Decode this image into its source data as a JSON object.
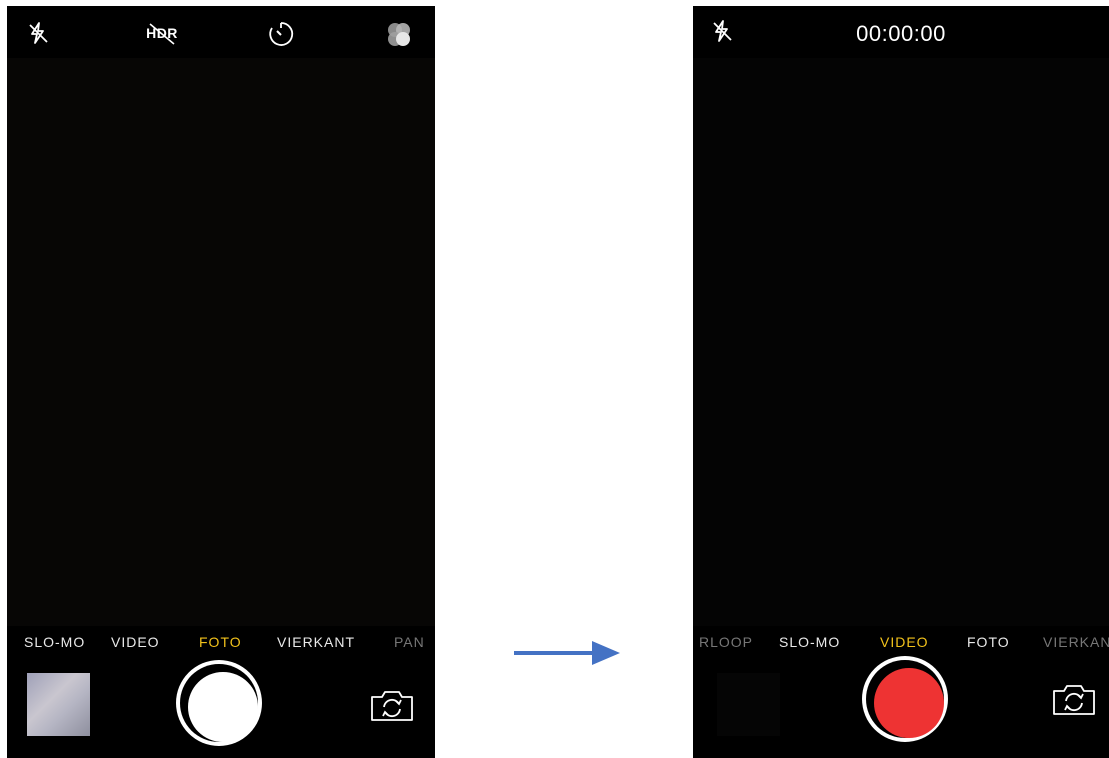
{
  "photo_screen": {
    "top_icons": [
      "flash-off-icon",
      "hdr-off-icon",
      "timer-icon",
      "filters-icon"
    ],
    "hdr_label": "HDR",
    "modes": [
      {
        "label": "SLO-MO",
        "state": "normal"
      },
      {
        "label": "VIDEO",
        "state": "normal"
      },
      {
        "label": "FOTO",
        "state": "active"
      },
      {
        "label": "VIERKANT",
        "state": "normal"
      },
      {
        "label": "PAN",
        "state": "faded"
      }
    ],
    "shutter": "photo-shutter",
    "flip_icon": "camera-flip-icon"
  },
  "video_screen": {
    "top_icons": [
      "flash-off-icon"
    ],
    "timer": "00:00:00",
    "modes": [
      {
        "label": "RLOOP",
        "state": "faded"
      },
      {
        "label": "SLO-MO",
        "state": "normal"
      },
      {
        "label": "VIDEO",
        "state": "active"
      },
      {
        "label": "FOTO",
        "state": "normal"
      },
      {
        "label": "VIERKAN",
        "state": "faded"
      }
    ],
    "shutter": "record-button",
    "flip_icon": "camera-flip-icon"
  },
  "transition_icon": "arrow-right-icon",
  "colors": {
    "active_mode": "#f2c21b",
    "record_red": "#ee3333",
    "arrow_blue": "#4472c4"
  }
}
